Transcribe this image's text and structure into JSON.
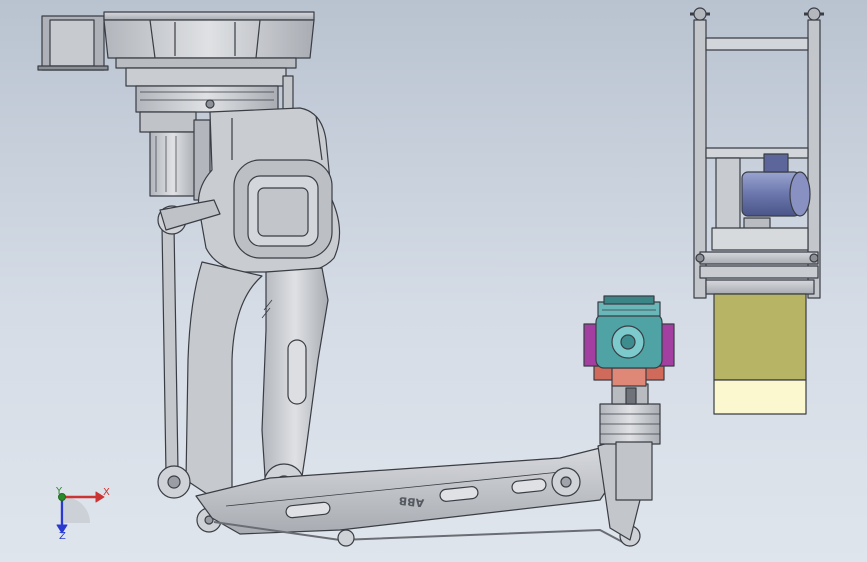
{
  "brand_text": "ABB",
  "triad": {
    "x_label": "X",
    "y_label": "Y",
    "z_label": "Z"
  },
  "colors": {
    "background_top": "#b9c3d0",
    "background_bottom": "#dfe5ec",
    "robot_body": "#c9ccd0",
    "outline": "#3a3d44",
    "teal_part": "#4fa3a5",
    "magenta_part": "#a23fa0",
    "red_part": "#d06a5a",
    "motor_blue": "#7a86b8",
    "olive_box": "#b7b465",
    "cream_box": "#fbf8cf"
  }
}
